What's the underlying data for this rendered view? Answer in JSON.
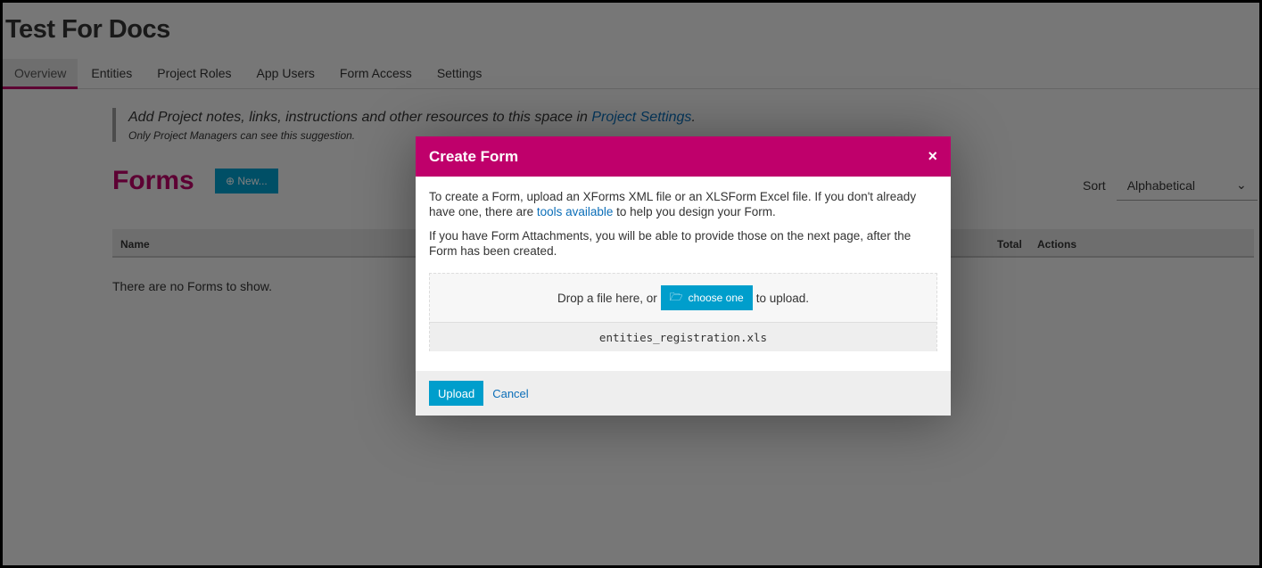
{
  "project": {
    "title": "Test For Docs"
  },
  "tabs": [
    {
      "label": "Overview",
      "active": true
    },
    {
      "label": "Entities"
    },
    {
      "label": "Project Roles"
    },
    {
      "label": "App Users"
    },
    {
      "label": "Form Access"
    },
    {
      "label": "Settings"
    }
  ],
  "notice": {
    "text": "Add Project notes, links, instructions and other resources to this space in ",
    "link": "Project Settings",
    "end": ".",
    "sub": "Only Project Managers can see this suggestion."
  },
  "forms": {
    "heading": "Forms",
    "new_label": "New...",
    "sort_label": "Sort",
    "sort_value": "Alphabetical",
    "columns": [
      "Name",
      "Total",
      "Actions"
    ],
    "empty": "There are no Forms to show."
  },
  "modal": {
    "title": "Create Form",
    "close": "×",
    "p1a": "To create a Form, upload an XForms XML file or an XLSForm Excel file. If you don't already have one, there are ",
    "p1link": "tools available",
    "p1b": " to help you design your Form.",
    "p2": "If you have Form Attachments, you will be able to provide those on the next page, after the Form has been created.",
    "drop_pre": "Drop a file here, or",
    "choose": "choose one",
    "drop_post": "to upload.",
    "filename": "entities_registration.xls",
    "upload": "Upload",
    "cancel": "Cancel"
  },
  "colors": {
    "brand": "#bf006b",
    "accent": "#009ecc",
    "link": "#0b6eb8"
  }
}
